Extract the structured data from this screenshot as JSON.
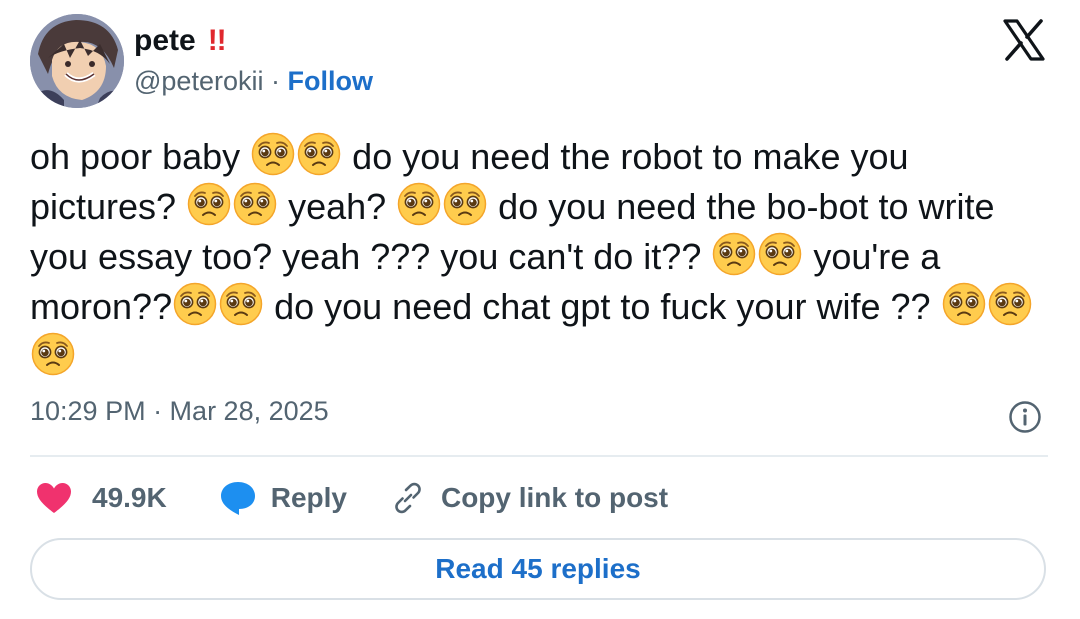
{
  "author": {
    "display_name": "pete",
    "badge_text": "!!",
    "handle": "@peterokii",
    "separator": " · ",
    "follow_label": "Follow"
  },
  "tweet": {
    "segments": [
      {
        "type": "text",
        "value": "oh poor baby "
      },
      {
        "type": "emoji",
        "icon": "pleading-face-icon"
      },
      {
        "type": "emoji",
        "icon": "pleading-face-icon"
      },
      {
        "type": "text",
        "value": " do you need the robot to make you pictures? "
      },
      {
        "type": "emoji",
        "icon": "pleading-face-icon"
      },
      {
        "type": "emoji",
        "icon": "pleading-face-icon"
      },
      {
        "type": "text",
        "value": " yeah? "
      },
      {
        "type": "emoji",
        "icon": "pleading-face-icon"
      },
      {
        "type": "emoji",
        "icon": "pleading-face-icon"
      },
      {
        "type": "text",
        "value": " do you need the bo-bot to write you essay too? yeah ??? you can't do it?? "
      },
      {
        "type": "emoji",
        "icon": "pleading-face-icon"
      },
      {
        "type": "emoji",
        "icon": "pleading-face-icon"
      },
      {
        "type": "text",
        "value": " you're a moron??"
      },
      {
        "type": "emoji",
        "icon": "pleading-face-icon"
      },
      {
        "type": "emoji",
        "icon": "pleading-face-icon"
      },
      {
        "type": "text",
        "value": " do you need chat gpt to fuck your wife ?? "
      },
      {
        "type": "emoji",
        "icon": "pleading-face-icon"
      },
      {
        "type": "emoji",
        "icon": "pleading-face-icon"
      },
      {
        "type": "emoji",
        "icon": "pleading-face-icon"
      }
    ],
    "timestamp": "10:29 PM · Mar 28, 2025"
  },
  "actions": {
    "like_count": "49.9K",
    "reply_label": "Reply",
    "copy_link_label": "Copy link to post"
  },
  "read_replies_label": "Read 45 replies",
  "icons": {
    "close": "x-logo-icon",
    "info": "info-icon",
    "like": "heart-icon",
    "reply": "speech-bubble-icon",
    "copy": "link-icon",
    "emoji": "pleading-face-icon"
  },
  "colors": {
    "heart": "#f0326e",
    "reply_bubble": "#1d8ff0",
    "link_blue": "#1d6fc9",
    "badge_red": "#e0282e",
    "emoji_yellow": "#ffcc4d"
  }
}
